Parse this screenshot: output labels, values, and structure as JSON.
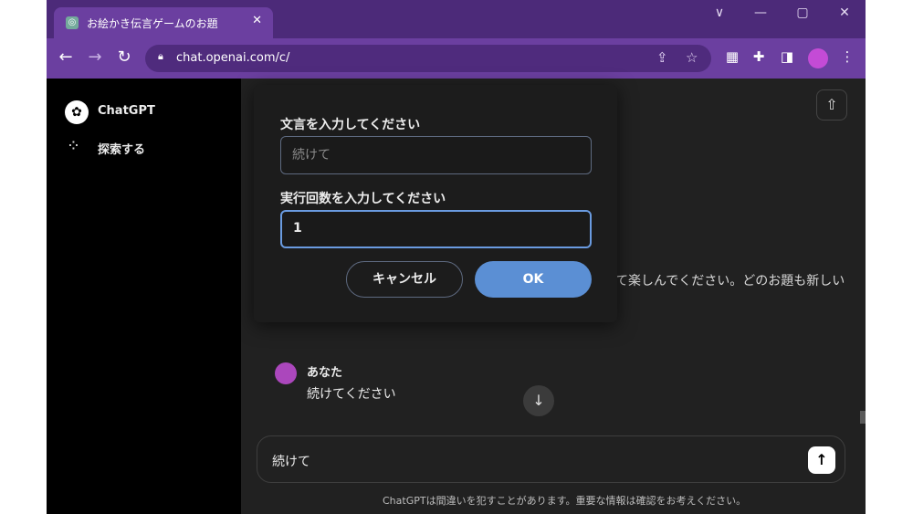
{
  "browser": {
    "tab_title": "お絵かき伝言ゲームのお題",
    "tab_close": "✕",
    "url": "chat.openai.com/c/",
    "controls": {
      "minimize": "—",
      "maximize": "▢",
      "close": "✕",
      "dropdown": "∨"
    },
    "nav": {
      "back": "←",
      "forward": "→",
      "reload": "↻"
    }
  },
  "sidebar": {
    "items": [
      {
        "label": "ChatGPT",
        "icon": "openai-logo-icon"
      },
      {
        "label": "探索する",
        "icon": "grid-icon"
      }
    ]
  },
  "main": {
    "background_text": "て楽しんでください。どのお題も新しい",
    "message": {
      "author": "あなた",
      "text": "続けてください"
    },
    "composer_value": "続けて",
    "disclaimer": "ChatGPTは間違いを犯すことがあります。重要な情報は確認をお考えください。"
  },
  "dialog": {
    "label1": "文言を入力してください",
    "input1_placeholder": "続けて",
    "label2": "実行回数を入力してください",
    "input2_value": "1",
    "cancel_label": "キャンセル",
    "ok_label": "OK"
  },
  "colors": {
    "titlebar": "#4c2a79",
    "toolbar": "#6b3fa0",
    "accent": "#5b8fd4",
    "avatar": "#ab47bc"
  }
}
